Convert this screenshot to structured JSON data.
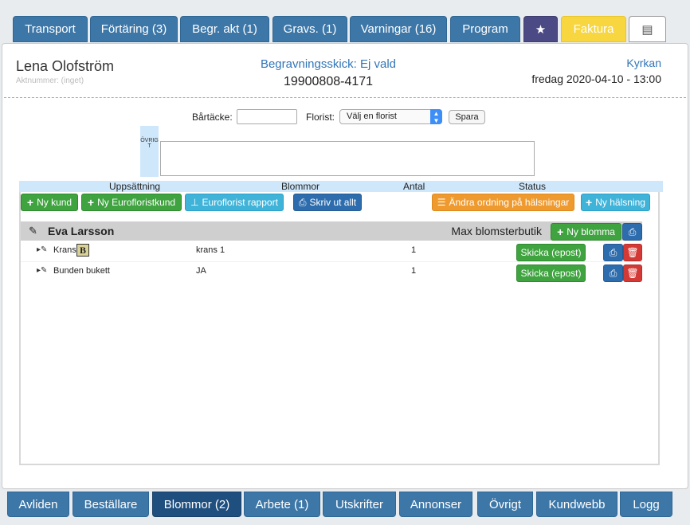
{
  "top_tabs": [
    {
      "label": "Transport"
    },
    {
      "label": "Förtäring (3)"
    },
    {
      "label": "Begr. akt (1)"
    },
    {
      "label": "Gravs. (1)"
    },
    {
      "label": "Varningar (16)"
    },
    {
      "label": "Program"
    },
    {
      "label": "★",
      "icon": "star-icon"
    },
    {
      "label": "Faktura"
    },
    {
      "label": "▤",
      "icon": "list-icon"
    }
  ],
  "header": {
    "name": "Lena Olofström",
    "aktnummer": "Aktnummer: (inget)",
    "skick": "Begravningsskick: Ej vald",
    "personnummer": "19900808-4171",
    "place": "Kyrkan",
    "datetime": "fredag 2020-04-10 - 13:00"
  },
  "form": {
    "bartacke_label": "Bårtäcke:",
    "bartacke_value": "",
    "florist_label": "Florist:",
    "florist_selected": "Välj en florist",
    "save_label": "Spara",
    "ovrigt_label": "ÖVRIGT",
    "ovrigt_value": ""
  },
  "columns": {
    "uppsattning": "Uppsättning",
    "blommor": "Blommor",
    "antal": "Antal",
    "status": "Status"
  },
  "toolbar": {
    "new_customer": "Ny kund",
    "new_euroflorist_customer": "Ny Eurofloristkund",
    "euroflorist_report": "Euroflorist rapport",
    "print_all": "Skriv ut allt",
    "change_order": "Ändra ordning på hälsningar",
    "new_greeting": "Ny hälsning"
  },
  "group": {
    "customer": "Eva Larsson",
    "max_label": "Max blomsterbutik",
    "new_flower": "Ny blomma"
  },
  "rows": [
    {
      "uppsattning": "Krans",
      "badge": "B",
      "blommor": "krans 1",
      "antal": "1",
      "send": "Skicka (epost)"
    },
    {
      "uppsattning": "Bunden bukett",
      "badge": "",
      "blommor": "JA",
      "antal": "1",
      "send": "Skicka (epost)"
    }
  ],
  "bottom_tabs": [
    {
      "label": "Avliden"
    },
    {
      "label": "Beställare"
    },
    {
      "label": "Blommor (2)",
      "active": true
    },
    {
      "label": "Arbete (1)"
    },
    {
      "label": "Utskrifter"
    },
    {
      "label": "Annonser"
    },
    {
      "label": "Övrigt"
    },
    {
      "label": "Kundwebb"
    },
    {
      "label": "Logg"
    }
  ],
  "colors": {
    "tab_blue": "#3d77a8",
    "tab_active": "#1f4f7f",
    "accent_link": "#3275b8",
    "green": "#3fa33f",
    "orange": "#ef9a2e",
    "light_blue": "#40b3d9",
    "red": "#d33a35",
    "yellow": "#f7d640",
    "purple": "#4b4a85"
  }
}
